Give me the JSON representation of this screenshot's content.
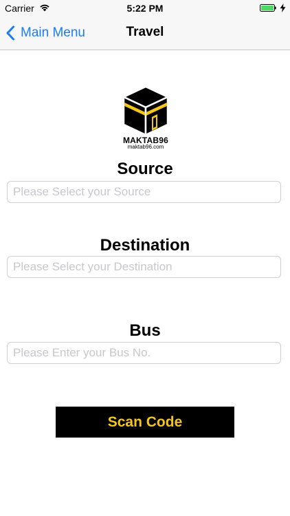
{
  "status_bar": {
    "carrier": "Carrier",
    "time": "5:22 PM",
    "icons": [
      "wifi-icon",
      "battery-icon",
      "charging-bolt-icon"
    ],
    "battery_color": "#4cd964"
  },
  "nav": {
    "back_label": "Main Menu",
    "title": "Travel",
    "accent_color": "#1a7cf5"
  },
  "logo": {
    "name": "MAKTAB96",
    "url": "maktab96.com",
    "icon": "kaaba-icon"
  },
  "form": {
    "source": {
      "label": "Source",
      "value": "",
      "placeholder": "Please Select your Source"
    },
    "destination": {
      "label": "Destination",
      "value": "",
      "placeholder": "Please Select your Destination"
    },
    "bus": {
      "label": "Bus",
      "value": "",
      "placeholder": "Please Enter your Bus No."
    }
  },
  "scan_button": {
    "label": "Scan Code",
    "background": "#000000",
    "text_color": "#f5c61a"
  }
}
